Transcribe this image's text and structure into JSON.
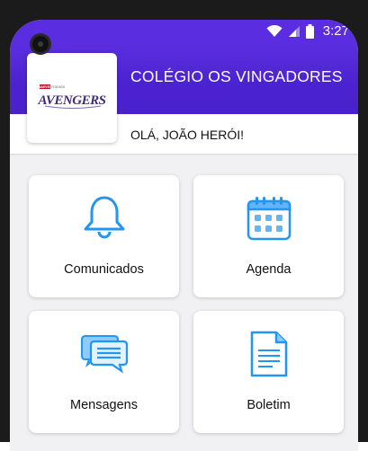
{
  "status_bar": {
    "time": "3:27",
    "icons": [
      "wifi-icon",
      "signal-icon",
      "battery-icon"
    ]
  },
  "header": {
    "school_name": "COLÉGIO OS VINGADORES",
    "greeting": "OLÁ, JOÃO HERÓI!",
    "logo": {
      "name": "avengers-logo",
      "top_text": "MARVEL STUDIOS",
      "main_text": "AVENGERS"
    }
  },
  "menu": [
    {
      "label": "Comunicados",
      "icon": "bell-icon"
    },
    {
      "label": "Agenda",
      "icon": "calendar-icon"
    },
    {
      "label": "Mensagens",
      "icon": "chat-icon"
    },
    {
      "label": "Boletim",
      "icon": "document-icon"
    }
  ],
  "colors": {
    "header": "#4b22cf",
    "icon": "#2196f3",
    "background": "#f1f1f3"
  }
}
